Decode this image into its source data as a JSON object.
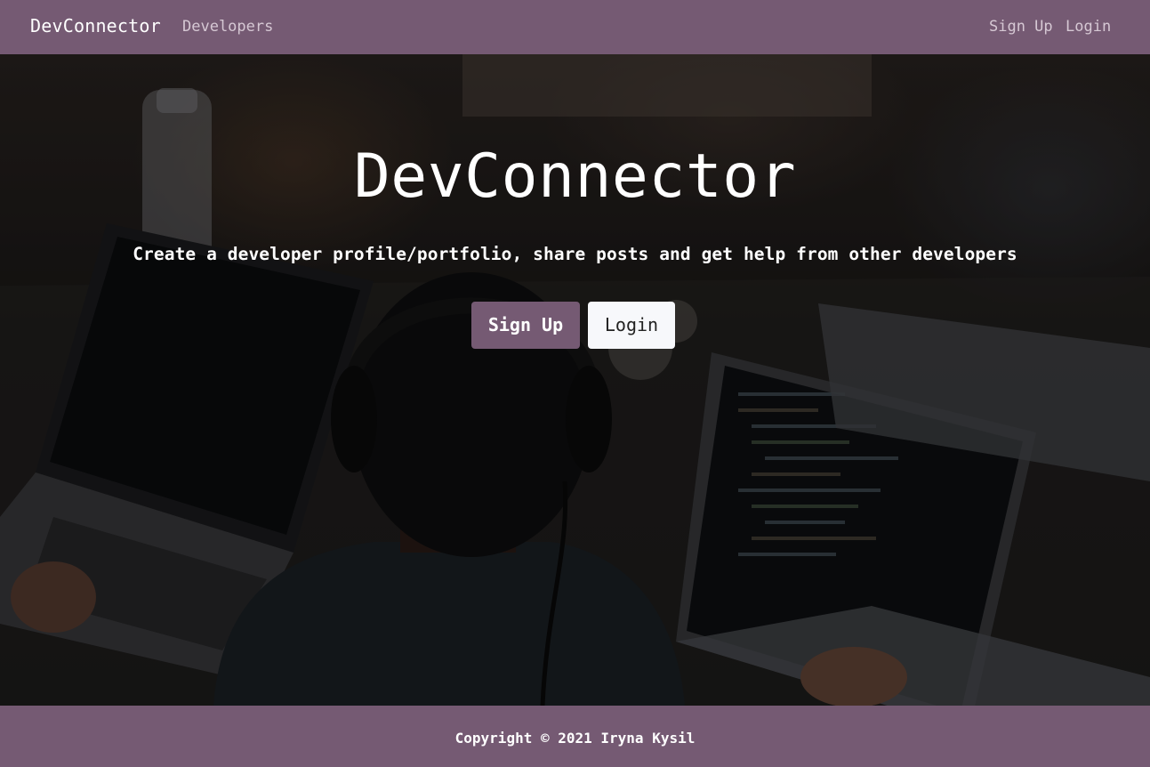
{
  "navbar": {
    "brand": "DevConnector",
    "links": {
      "developers": "Developers",
      "sign_up": "Sign Up",
      "login": "Login"
    }
  },
  "hero": {
    "title": "DevConnector",
    "subtitle": "Create a developer profile/portfolio, share posts and get help from other developers",
    "buttons": {
      "sign_up": "Sign Up",
      "login": "Login"
    }
  },
  "footer": {
    "copyright": "Copyright © 2021 Iryna Kysil"
  },
  "colors": {
    "brand": "#755a73",
    "text_light": "#ffffff",
    "button_light": "#f7f8fb"
  }
}
